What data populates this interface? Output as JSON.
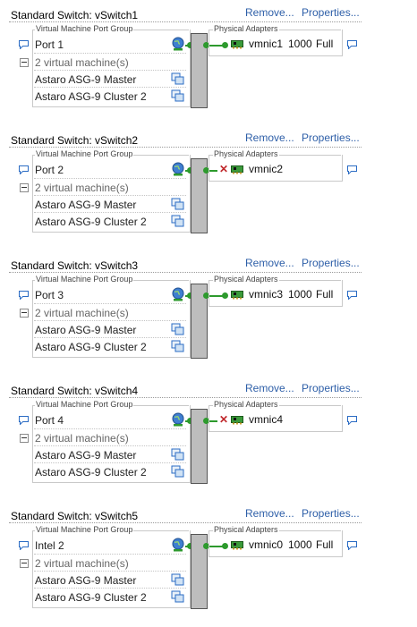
{
  "common": {
    "remove_label": "Remove...",
    "properties_label": "Properties...",
    "port_group_legend": "Virtual Machine Port Group",
    "physical_adapters_legend": "Physical Adapters",
    "vm_count": "2 virtual machine(s)",
    "vm1": "Astaro ASG-9 Master",
    "vm2": "Astaro ASG-9 Cluster 2"
  },
  "colors": {
    "link": "#2e5fa8",
    "connected": "#2d9a2d",
    "disconnected": "#c0282c"
  },
  "switches": [
    {
      "title": "Standard Switch: vSwitch1",
      "port": "Port 1",
      "nic": "vmnic1",
      "speed": "1000",
      "duplex": "Full",
      "connected": true
    },
    {
      "title": "Standard Switch: vSwitch2",
      "port": "Port 2",
      "nic": "vmnic2",
      "speed": "",
      "duplex": "",
      "connected": false
    },
    {
      "title": "Standard Switch: vSwitch3",
      "port": "Port 3",
      "nic": "vmnic3",
      "speed": "1000",
      "duplex": "Full",
      "connected": true
    },
    {
      "title": "Standard Switch: vSwitch4",
      "port": "Port 4",
      "nic": "vmnic4",
      "speed": "",
      "duplex": "",
      "connected": false
    },
    {
      "title": "Standard Switch: vSwitch5",
      "port": "Intel 2",
      "nic": "vmnic0",
      "speed": "1000",
      "duplex": "Full",
      "connected": true
    }
  ]
}
